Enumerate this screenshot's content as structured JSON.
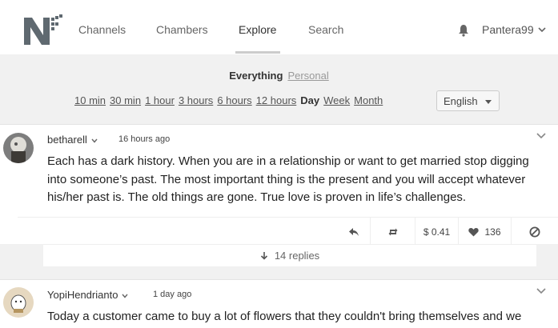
{
  "nav": {
    "items": [
      {
        "label": "Channels"
      },
      {
        "label": "Chambers"
      },
      {
        "label": "Explore"
      },
      {
        "label": "Search"
      }
    ],
    "active": "Explore",
    "user": "Pantera99",
    "bell_icon": "bell-icon"
  },
  "feed": {
    "everything_label": "Everything",
    "personal_label": "Personal"
  },
  "timebar": {
    "items": [
      "10 min",
      "30 min",
      "1 hour",
      "3 hours",
      "6 hours",
      "12 hours",
      "Day",
      "Week",
      "Month"
    ],
    "active": "Day"
  },
  "language": {
    "selected": "English"
  },
  "posts": [
    {
      "author": "betharell",
      "time": "16 hours ago",
      "body": "Each has a dark history. When you are in a relationship or want to get married stop digging into someone’s past. The most important thing is the present and you will accept whatever his/her past is. The old things are gone. True love is proven in life’s challenges.",
      "payout": "$ 0.41",
      "likes": "136",
      "replies": "14 replies"
    },
    {
      "author": "YopiHendrianto",
      "time": "1 day ago",
      "body": "Today a customer came to buy a lot of flowers that they couldn't bring themselves and we"
    }
  ],
  "colors": {
    "accent": "#333333",
    "muted": "#999999",
    "background": "#f1f1f1"
  }
}
